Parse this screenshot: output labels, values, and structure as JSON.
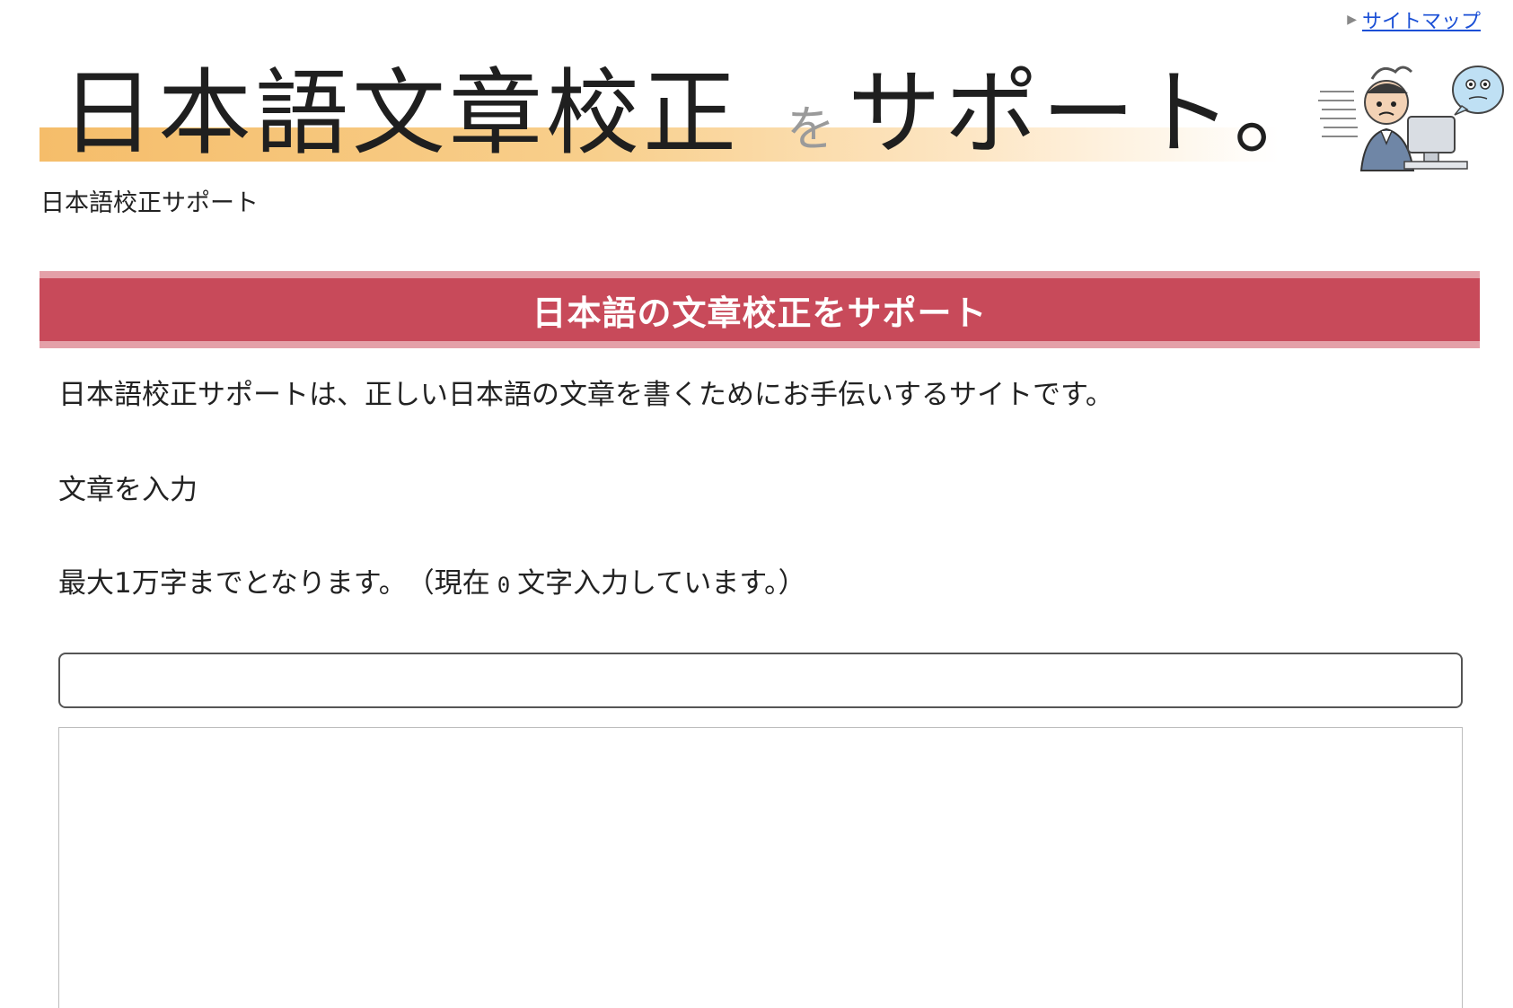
{
  "nav": {
    "sitemap_label": "サイトマップ"
  },
  "banner": {
    "title_part1": "日本語文章校正",
    "title_wo": "を",
    "title_part2": "サポート。"
  },
  "site_name": "日本語校正サポート",
  "heading": "日本語の文章校正をサポート",
  "intro": "日本語校正サポートは、正しい日本語の文章を書くためにお手伝いするサイトです。",
  "form": {
    "input_label": "文章を入力",
    "limit_prefix": "最大1万字までとなります。　（現在",
    "char_count": "0",
    "limit_suffix": "文字入力しています。）",
    "title_value": "",
    "body_value": ""
  },
  "colors": {
    "heading_bg": "#c84a5a",
    "heading_border": "#e4a0a8",
    "banner_stripe": "#f5bd6a",
    "link": "#1a4fd6"
  },
  "icons": {
    "sitemap_marker": "triangle-right-icon",
    "mascot": "worried-man-at-computer-illustration"
  }
}
